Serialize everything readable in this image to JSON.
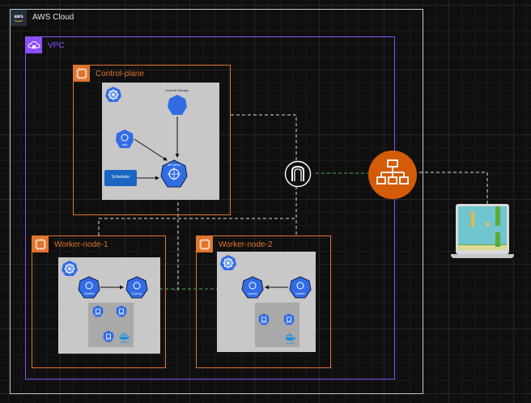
{
  "groups": {
    "aws_cloud": "AWS Cloud",
    "vpc": "VPC",
    "control_plane": "Control-plane",
    "worker_1": "Worker-node-1",
    "worker_2": "Worker-node-2"
  },
  "control_plane": {
    "controller_manager": "controller Manager",
    "etcd": "etcd",
    "api_server": "API server",
    "scheduler": "Scheduler"
  },
  "worker_1": {
    "kubelet": "Kubelet",
    "kube_proxy": "K-proxy",
    "pod_a": "pod",
    "pod_b": "pod",
    "pod_c": "pod",
    "docker": "docker"
  },
  "worker_2": {
    "kube_proxy": "k-proxy",
    "kubelet": "kubelet",
    "pod_a": "pod",
    "pod_b": "pod",
    "docker": "docker"
  },
  "icons": [
    "aws-logo",
    "vpc",
    "ec2-chip",
    "kubernetes",
    "internet-gateway",
    "elastic-load-balancer",
    "laptop",
    "flappy-bird-game",
    "docker"
  ],
  "colors": {
    "aws_cloud_border": "#c8c8c8",
    "vpc_border": "#8c4fff",
    "node_border": "#e0742d",
    "load_balancer": "#d45b07",
    "kubernetes_blue": "#326ce5",
    "scheduler_box": "#1a66c2"
  }
}
